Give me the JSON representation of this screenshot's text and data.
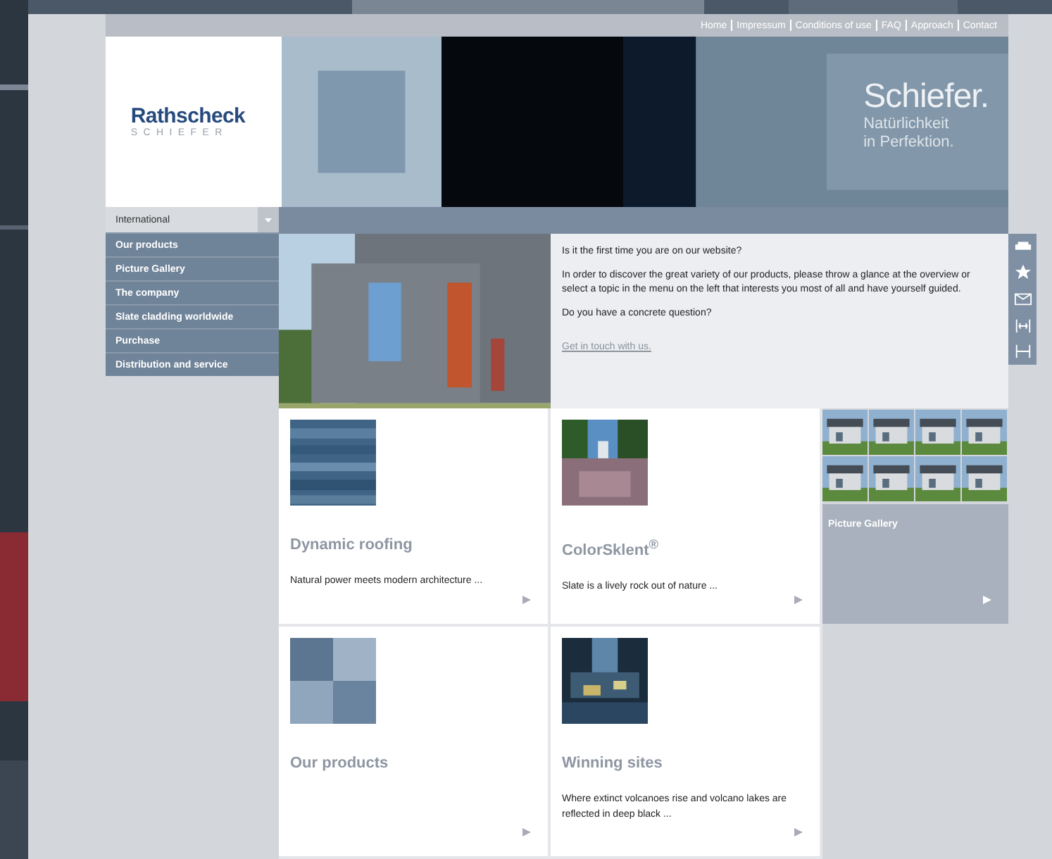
{
  "top_links": [
    "Home",
    "Impressum",
    "Conditions of use",
    "FAQ",
    "Approach",
    "Contact"
  ],
  "logo": {
    "name": "Rathscheck",
    "sub": "SCHIEFER"
  },
  "banner": {
    "title": "Schiefer.",
    "subtitle": [
      "Natürlichkeit",
      "in Perfektion."
    ]
  },
  "nav": {
    "dropdown": "International",
    "items": [
      "Our products",
      "Picture Gallery",
      "The company",
      "Slate cladding worldwide",
      "Purchase",
      "Distribution and service"
    ]
  },
  "intro": {
    "paragraphs": [
      "Is it the first time you are on our website?",
      "In order to discover the great variety of our products, please throw a glance at the overview or select a topic in the menu on the left that interests you most of all and have yourself guided.",
      "Do you have a concrete question?"
    ],
    "link": "Get in touch with us."
  },
  "cards": [
    {
      "title": "Dynamic roofing",
      "text": "Natural power meets modern architecture ..."
    },
    {
      "title": "ColorSklent$^{®}$",
      "text": "Slate is a lively rock out of nature ..."
    },
    {
      "title": "Our products"
    },
    {
      "title": "Winning sites",
      "text": "Where extinct volcanoes rise and volcano lakes are reflected in deep black ..."
    }
  ],
  "gallery": {
    "label": "Picture Gallery"
  }
}
